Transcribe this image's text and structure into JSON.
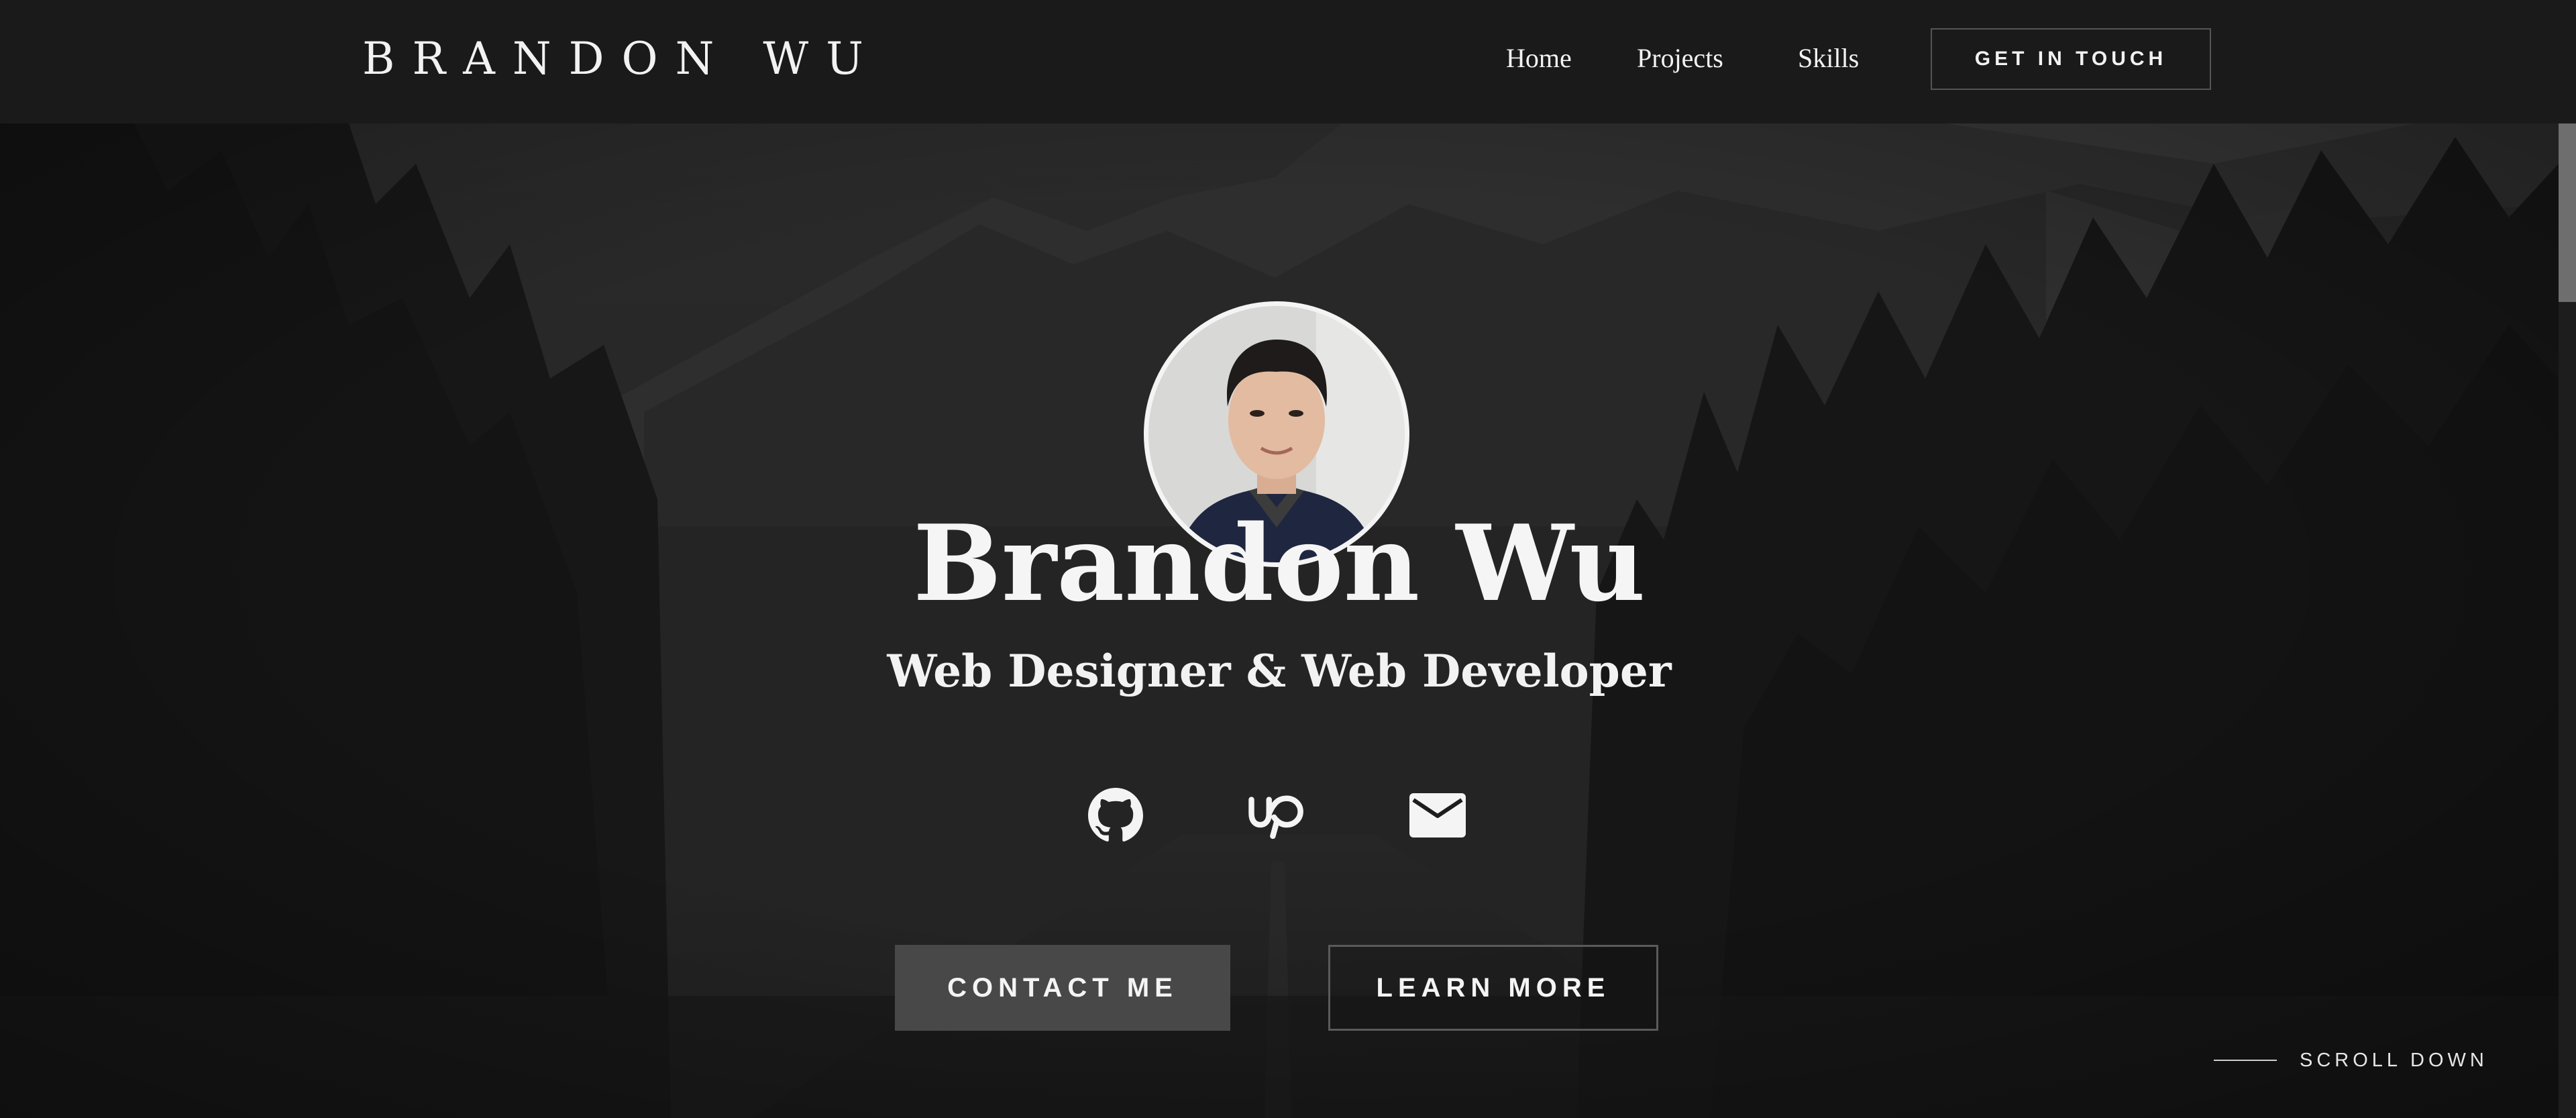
{
  "header": {
    "brand": "BRANDON WU",
    "nav": {
      "home": "Home",
      "projects": "Projects",
      "skills": "Skills"
    },
    "cta": "GET IN TOUCH"
  },
  "hero": {
    "name": "Brandon Wu",
    "role": "Web Designer & Web Developer",
    "social_icons": [
      "github-icon",
      "upwork-icon",
      "mail-icon"
    ],
    "buttons": {
      "contact": "CONTACT ME",
      "learn": "LEARN MORE"
    },
    "scroll_label": "SCROLL DOWN"
  },
  "colors": {
    "header_bg": "#1a1a1a",
    "text": "#f2f2f2",
    "contact_button_bg": "#484848",
    "outline": "#5a5a5a"
  }
}
